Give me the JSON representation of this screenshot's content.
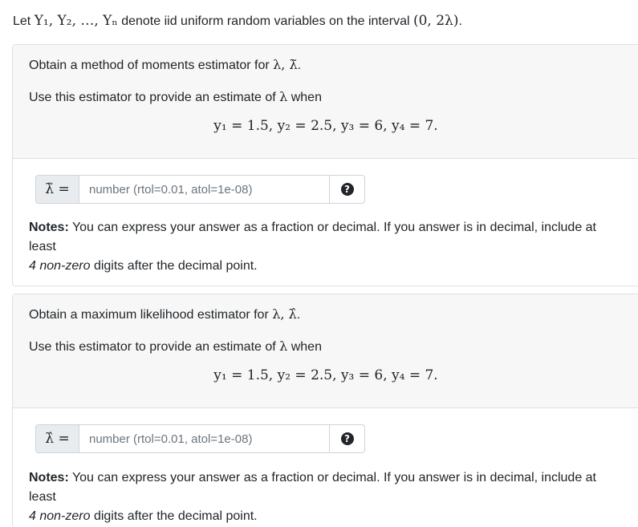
{
  "intro": {
    "prefix": "Let ",
    "vars": "Y₁, Y₂, …, Yₙ",
    "middle": " denote iid uniform random variables on the interval ",
    "interval": "(0, 2λ)",
    "suffix": "."
  },
  "questions": [
    {
      "prompt_prefix": "Obtain a method of moments estimator for ",
      "prompt_math": "λ, λ̃",
      "prompt_suffix": ".",
      "use_prefix": "Use this estimator to provide an estimate of ",
      "use_math": "λ",
      "use_suffix": " when",
      "equation": "y₁ = 1.5, y₂ = 2.5, y₃ = 6, y₄ = 7.",
      "input_label": "λ̃ =",
      "input_placeholder": "number (rtol=0.01, atol=1e-08)",
      "help_symbol": "?",
      "notes_bold": "Notes:",
      "notes_text1": " You can express your answer as a fraction or decimal. If you answer is in decimal, include at least",
      "notes_em": "4 non-zero",
      "notes_text2": " digits after the decimal point."
    },
    {
      "prompt_prefix": "Obtain a maximum likelihood estimator for ",
      "prompt_math": "λ, λ̂",
      "prompt_suffix": ".",
      "use_prefix": "Use this estimator to provide an estimate of ",
      "use_math": "λ",
      "use_suffix": " when",
      "equation": "y₁ = 1.5, y₂ = 2.5, y₃ = 6, y₄ = 7.",
      "input_label": "λ̂ =",
      "input_placeholder": "number (rtol=0.01, atol=1e-08)",
      "help_symbol": "?",
      "notes_bold": "Notes:",
      "notes_text1": " You can express your answer as a fraction or decimal. If you answer is in decimal, include at least",
      "notes_em": "4 non-zero",
      "notes_text2": " digits after the decimal point."
    }
  ]
}
